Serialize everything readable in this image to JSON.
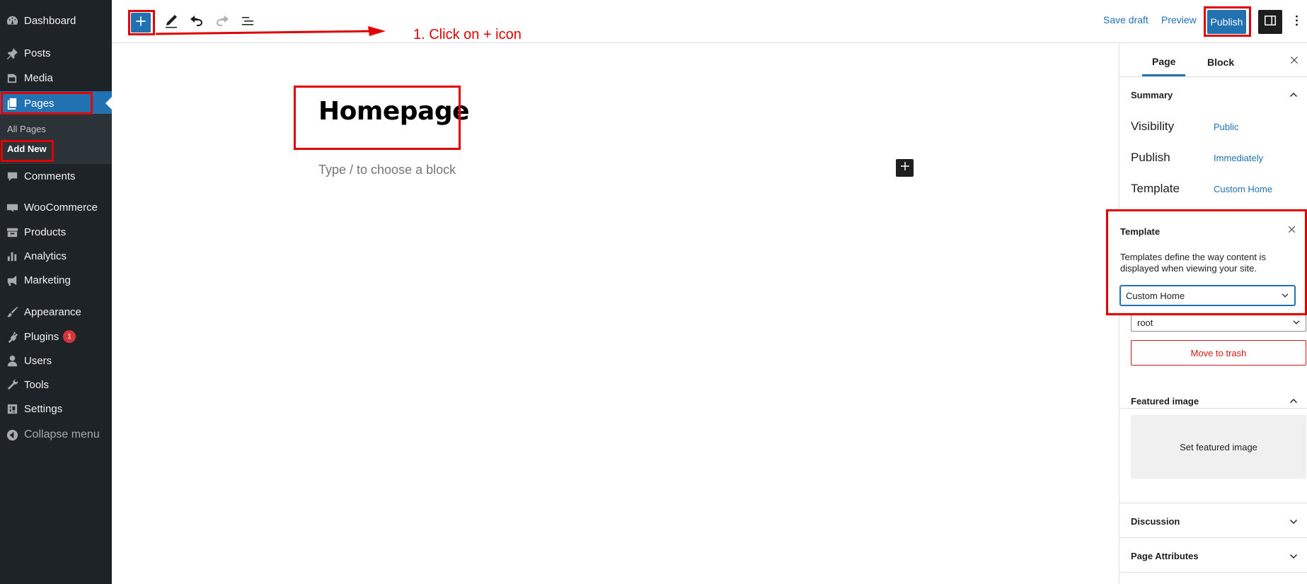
{
  "admin_menu": {
    "items": [
      {
        "label": "Dashboard",
        "icon": "dashboard-icon"
      },
      {
        "label": "Posts",
        "icon": "pin-icon"
      },
      {
        "label": "Media",
        "icon": "media-icon"
      },
      {
        "label": "Pages",
        "icon": "pages-icon"
      },
      {
        "label": "Comments",
        "icon": "comments-icon"
      },
      {
        "label": "WooCommerce",
        "icon": "woo-icon"
      },
      {
        "label": "Products",
        "icon": "archive-icon"
      },
      {
        "label": "Analytics",
        "icon": "chart-bar-icon"
      },
      {
        "label": "Marketing",
        "icon": "megaphone-icon"
      },
      {
        "label": "Appearance",
        "icon": "brush-icon"
      },
      {
        "label": "Plugins",
        "icon": "plugin-icon",
        "badge": "1"
      },
      {
        "label": "Users",
        "icon": "user-icon"
      },
      {
        "label": "Tools",
        "icon": "wrench-icon"
      },
      {
        "label": "Settings",
        "icon": "settings-icon"
      }
    ],
    "submenu": {
      "all_pages": "All Pages",
      "add_new": "Add New"
    },
    "collapse": "Collapse menu"
  },
  "toolbar": {
    "save_draft": "Save draft",
    "preview": "Preview",
    "publish": "Publish"
  },
  "editor": {
    "title": "Homepage",
    "placeholder": "Type / to choose a block"
  },
  "settings_panel": {
    "tabs": [
      "Page",
      "Block"
    ],
    "summary": {
      "title": "Summary",
      "rows": [
        {
          "label": "Visibility",
          "value": "Public"
        },
        {
          "label": "Publish",
          "value": "Immediately"
        },
        {
          "label": "Template",
          "value": "Custom Home"
        }
      ],
      "author": "root",
      "trash": "Move to trash"
    },
    "featured_image": {
      "title": "Featured image",
      "button": "Set featured image"
    },
    "discussion": {
      "title": "Discussion"
    },
    "page_attributes": {
      "title": "Page Attributes"
    }
  },
  "template_popover": {
    "title": "Template",
    "description": "Templates define the way content is displayed when viewing your site.",
    "selected": "Custom Home"
  },
  "annotation": {
    "text": "1. Click on + icon",
    "color": "#e00000"
  },
  "colors": {
    "accent": "#2271b1",
    "admin_bg": "#1d2327",
    "danger": "#cc1818"
  }
}
